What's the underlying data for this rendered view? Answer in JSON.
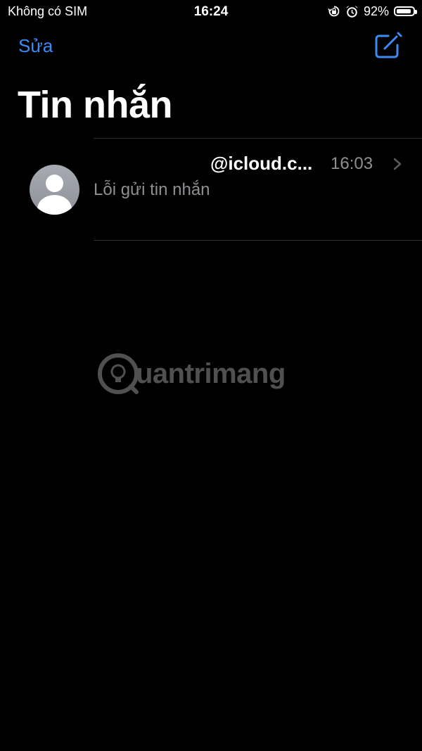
{
  "status_bar": {
    "carrier": "Không có SIM",
    "time": "16:24",
    "battery_percent": "92%",
    "battery_level": 0.92,
    "icons": [
      "orientation-lock-icon",
      "alarm-icon",
      "battery-icon"
    ]
  },
  "nav": {
    "edit_label": "Sửa",
    "compose_icon": "compose-icon",
    "accent_color": "#3b8bf5"
  },
  "title": "Tin nhắn",
  "conversations": [
    {
      "sender": "@icloud.c...",
      "time": "16:03",
      "preview": "Lỗi gửi tin nhắn",
      "avatar_icon": "contact-avatar-icon"
    }
  ],
  "watermark": {
    "text": "uantrimang"
  }
}
